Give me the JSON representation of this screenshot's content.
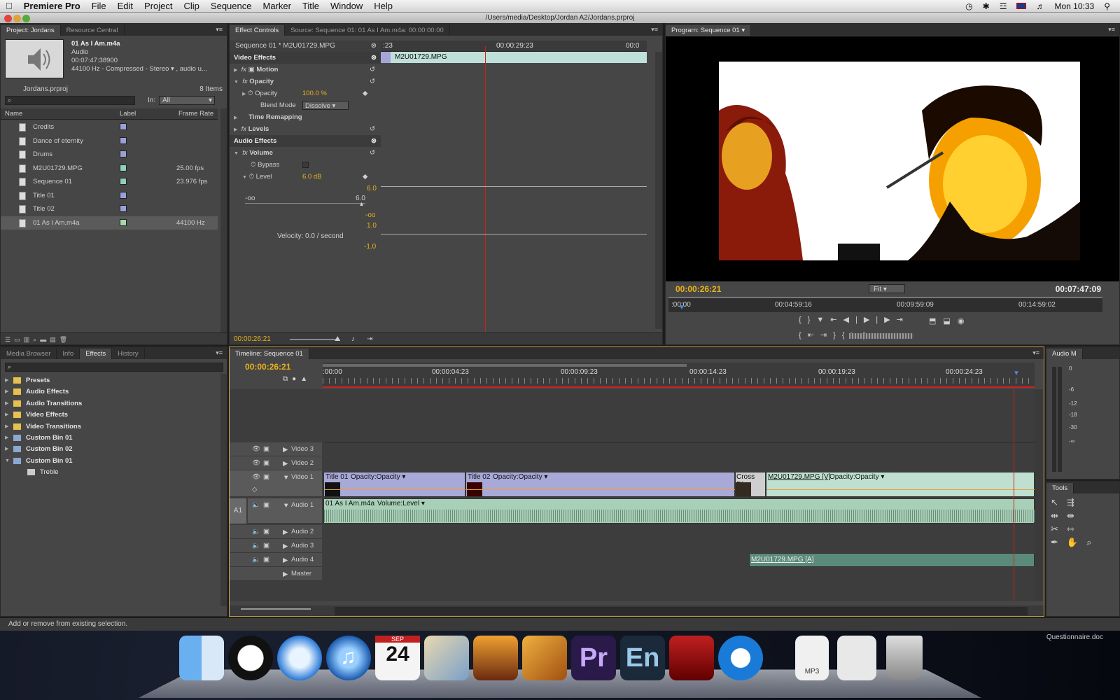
{
  "menubar": {
    "app": "Premiere Pro",
    "items": [
      "File",
      "Edit",
      "Project",
      "Clip",
      "Sequence",
      "Marker",
      "Title",
      "Window",
      "Help"
    ],
    "clock": "Mon 10:33"
  },
  "window_title": "/Users/media/Desktop/Jordan A2/Jordans.prproj",
  "project": {
    "tabs": [
      "Project: Jordans",
      "Resource Central"
    ],
    "preview": {
      "name": "01 As I Am.m4a",
      "type": "Audio",
      "duration": "00:07:47:38900",
      "info": "44100 Hz - Compressed - Stereo ▾ , audio u..."
    },
    "file": "Jordans.prproj",
    "count": "8 Items",
    "in_label": "In:",
    "in_value": "All",
    "columns": [
      "Name",
      "Label",
      "Frame Rate"
    ],
    "items": [
      {
        "name": "Credits",
        "rate": "",
        "color": "#9aa0d8"
      },
      {
        "name": "Dance of eternity",
        "rate": "",
        "color": "#9aa0d8"
      },
      {
        "name": "Drums",
        "rate": "",
        "color": "#9aa0d8"
      },
      {
        "name": "M2U01729.MPG",
        "rate": "25.00 fps",
        "color": "#8fcfbf"
      },
      {
        "name": "Sequence 01",
        "rate": "23.976 fps",
        "color": "#8fcfbf"
      },
      {
        "name": "Title 01",
        "rate": "",
        "color": "#9aa0d8"
      },
      {
        "name": "Title 02",
        "rate": "",
        "color": "#9aa0d8"
      },
      {
        "name": "01 As I Am.m4a",
        "rate": "44100 Hz",
        "color": "#a8d8a8"
      }
    ]
  },
  "effect_controls": {
    "tabs": [
      "Effect Controls",
      "Source: Sequence 01: 01 As I Am.m4a: 00:00:00:00"
    ],
    "sequence": "Sequence 01 * M2U01729.MPG",
    "ruler_left": ":23",
    "ruler_mid": "00:00:29:23",
    "ruler_right": "00:0",
    "clip": "M2U01729.MPG",
    "video_effects": "Video Effects",
    "motion": "Motion",
    "opacity": "Opacity",
    "opacity_param": "Opacity",
    "opacity_value": "100.0 %",
    "blend_label": "Blend Mode",
    "blend_value": "Dissolve",
    "time_remap": "Time Remapping",
    "levels": "Levels",
    "audio_effects": "Audio Effects",
    "volume": "Volume",
    "bypass": "Bypass",
    "level": "Level",
    "level_value": "6.0 dB",
    "graph_top": "6.0",
    "graph_min": "-oo",
    "graph_max": "6.0",
    "graph_neg": "-oo",
    "graph_one": "1.0",
    "velocity": "Velocity: 0.0 / second",
    "graph_neg1": "-1.0",
    "timecode": "00:00:26:21"
  },
  "program": {
    "tab": "Program: Sequence 01",
    "timecode": "00:00:26:21",
    "fit": "Fit",
    "duration": "00:07:47:09",
    "ruler": [
      ":00:00",
      "00:04:59:16",
      "00:09:59:09",
      "00:14:59:02"
    ]
  },
  "effects_panel": {
    "tabs": [
      "Media Browser",
      "Info",
      "Effects",
      "History"
    ],
    "items": [
      {
        "label": "Presets",
        "indent": 0,
        "type": "star"
      },
      {
        "label": "Audio Effects",
        "indent": 0,
        "type": "folder"
      },
      {
        "label": "Audio Transitions",
        "indent": 0,
        "type": "folder"
      },
      {
        "label": "Video Effects",
        "indent": 0,
        "type": "folder"
      },
      {
        "label": "Video Transitions",
        "indent": 0,
        "type": "folder"
      },
      {
        "label": "Custom Bin 01",
        "indent": 0,
        "type": "bin"
      },
      {
        "label": "Custom Bin 02",
        "indent": 0,
        "type": "bin"
      },
      {
        "label": "Custom Bin 01",
        "indent": 0,
        "type": "bin"
      },
      {
        "label": "Treble",
        "indent": 1,
        "type": "fx"
      }
    ]
  },
  "timeline": {
    "tab": "Timeline: Sequence 01",
    "timecode": "00:00:26:21",
    "ruler": [
      ":00:00",
      "00:00:04:23",
      "00:00:09:23",
      "00:00:14:23",
      "00:00:19:23",
      "00:00:24:23"
    ],
    "tracks": [
      "Video 3",
      "Video 2",
      "Video 1",
      "Audio 1",
      "Audio 2",
      "Audio 3",
      "Audio 4",
      "Master"
    ],
    "a1": "A1",
    "clips": {
      "title01": "Title 01",
      "title01_fx": "Opacity:Opacity ▾",
      "title02": "Title 02",
      "title02_fx": "Opacity:Opacity ▾",
      "cross": "Cross Dis",
      "mpg_v": "M2U01729.MPG [V]",
      "mpg_v_fx": "Opacity:Opacity ▾",
      "audio1": "01 As I Am.m4a",
      "audio1_fx": "Volume:Level ▾",
      "mpg_a": "M2U01729.MPG [A]"
    }
  },
  "audio_meter": {
    "title": "Audio M",
    "scale": [
      "0",
      "-6",
      "-12",
      "-18",
      "-30",
      "-∞"
    ]
  },
  "tools": {
    "title": "Tools"
  },
  "status": "Add or remove from existing selection.",
  "dock": {
    "calendar_month": "SEP",
    "calendar_day": "24",
    "pr": "Pr",
    "en": "En",
    "mp3": "MP3",
    "doc": "Questionnaire.doc"
  }
}
